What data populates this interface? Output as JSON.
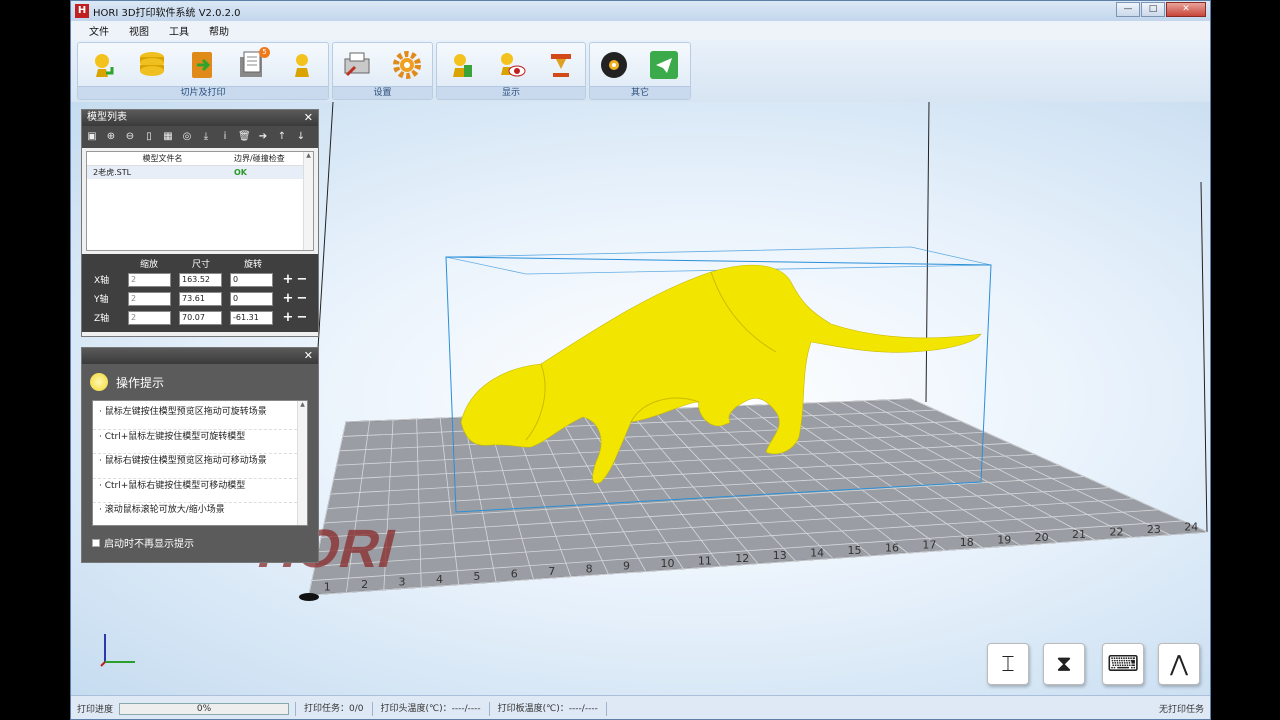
{
  "window": {
    "title": "HORI 3D打印软件系统 V2.0.2.0",
    "logo": "H"
  },
  "menu": [
    "文件",
    "视图",
    "工具",
    "帮助"
  ],
  "ribbon": {
    "groups": [
      {
        "label": "切片及打印",
        "icons": [
          "load-model-icon",
          "slice-icon",
          "export-gcode-icon",
          "print-queue-icon",
          "piece-icon"
        ],
        "badge": "5"
      },
      {
        "label": "设置",
        "icons": [
          "printer-settings-icon",
          "gear-icon"
        ]
      },
      {
        "label": "显示",
        "icons": [
          "model-view-icon",
          "preview-eye-icon",
          "support-view-icon"
        ]
      },
      {
        "label": "其它",
        "icons": [
          "disk-icon",
          "send-icon"
        ]
      }
    ]
  },
  "model_panel": {
    "title": "模型列表",
    "columns": [
      "模型文件名",
      "边界/碰撞检查"
    ],
    "rows": [
      {
        "name": "2老虎.STL",
        "status": "OK"
      }
    ],
    "xform": {
      "headers": [
        "缩放",
        "尺寸",
        "旋转"
      ],
      "rows": [
        {
          "axis": "X轴",
          "scale": "2",
          "size": "163.52",
          "rotate": "0"
        },
        {
          "axis": "Y轴",
          "scale": "2",
          "size": "73.61",
          "rotate": "0"
        },
        {
          "axis": "Z轴",
          "scale": "2",
          "size": "70.07",
          "rotate": "-61.31"
        }
      ]
    }
  },
  "hint_panel": {
    "title": "操作提示",
    "items": [
      "· 鼠标左键按住模型预览区拖动可旋转场景",
      "· Ctrl+鼠标左键按住模型可旋转模型",
      "· 鼠标右键按住模型预览区拖动可移动场景",
      "· Ctrl+鼠标右键按住模型可移动模型",
      "· 滚动鼠标滚轮可放大/缩小场景"
    ],
    "footer": "启动时不再显示提示"
  },
  "bed": {
    "logo": "HORI",
    "x_ticks": [
      "1",
      "2",
      "3",
      "4",
      "5",
      "6",
      "7",
      "8",
      "9",
      "10",
      "11",
      "12",
      "13",
      "14",
      "15",
      "16",
      "17",
      "18",
      "19",
      "20",
      "21",
      "22",
      "23",
      "24"
    ]
  },
  "colors": {
    "model": "#f2e600",
    "bed": "#9a9ea4",
    "bbox": "#2a8fd8",
    "logo": "#8a2a2a"
  },
  "status": {
    "progress_label": "打印进度",
    "progress_value": 0,
    "progress_text": "0%",
    "task": "打印任务：0/0",
    "head_temp": "打印头温度(℃)：----/----",
    "bed_temp": "打印板温度(℃)：----/----",
    "right": "无打印任务"
  }
}
